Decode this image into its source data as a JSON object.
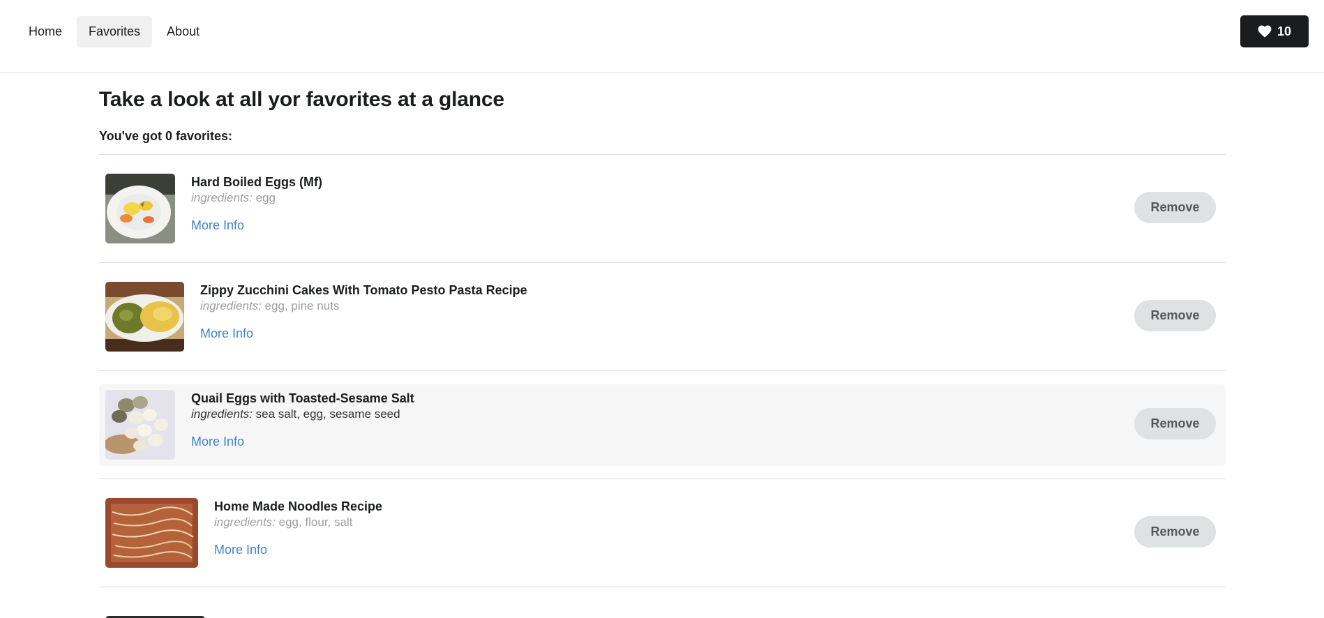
{
  "nav": {
    "items": [
      {
        "label": "Home",
        "active": false
      },
      {
        "label": "Favorites",
        "active": true
      },
      {
        "label": "About",
        "active": false
      }
    ],
    "favorites_badge": {
      "icon": "heart-icon",
      "count": "10"
    }
  },
  "page": {
    "title": "Take a look at all yor favorites at a glance",
    "count_text": "You've got 0 favorites:"
  },
  "favorites": [
    {
      "title": "Hard Boiled Eggs (Mf)",
      "ingredients_label": "ingredients:",
      "ingredients": "egg",
      "more_info": "More Info",
      "remove": "Remove"
    },
    {
      "title": "Zippy Zucchini Cakes With Tomato Pesto Pasta Recipe",
      "ingredients_label": "ingredients:",
      "ingredients": "egg, pine nuts",
      "more_info": "More Info",
      "remove": "Remove"
    },
    {
      "title": "Quail Eggs with Toasted-Sesame Salt",
      "ingredients_label": "ingredients:",
      "ingredients": "sea salt, egg, sesame seed",
      "more_info": "More Info",
      "remove": "Remove"
    },
    {
      "title": "Home Made Noodles Recipe",
      "ingredients_label": "ingredients:",
      "ingredients": "egg, flour, salt",
      "more_info": "More Info",
      "remove": "Remove"
    }
  ],
  "colors": {
    "link": "#4183c4",
    "badge_bg": "#1b1c1d",
    "remove_bg": "#e0e1e2",
    "hover_row": "#f6f6f6"
  }
}
